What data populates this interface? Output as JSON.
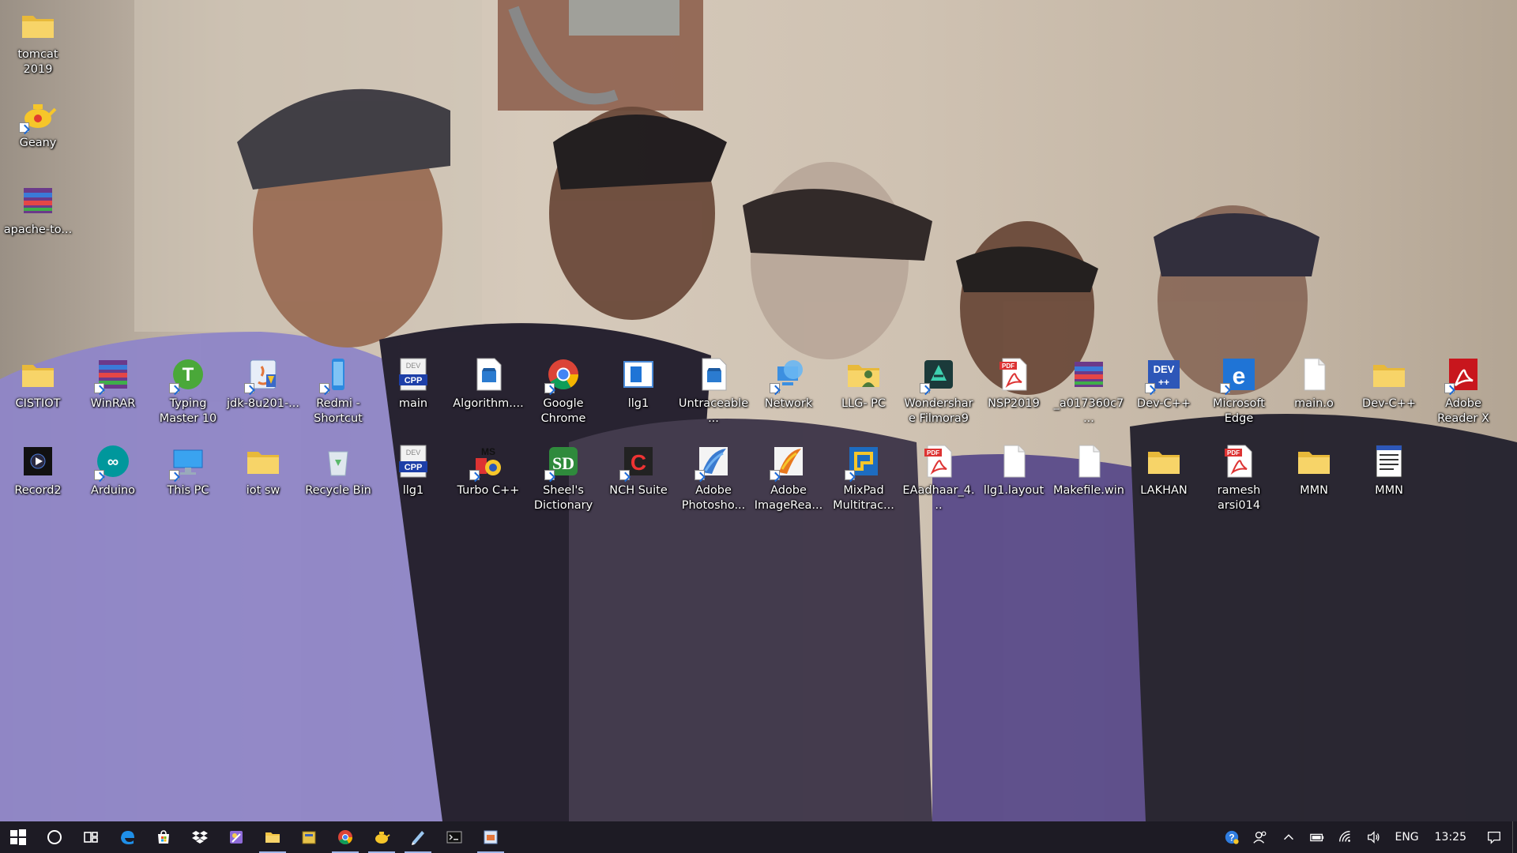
{
  "desktop": {
    "icons": [
      {
        "label": "tomcat 2019",
        "icon": "folder-icon"
      },
      {
        "label": "Geany",
        "icon": "geany-icon"
      },
      {
        "label": "apache-to...",
        "icon": "winrar-archive-icon"
      },
      {
        "label": "CISTIOT",
        "icon": "folder-icon"
      },
      {
        "label": "WinRAR",
        "icon": "winrar-icon"
      },
      {
        "label": "Typing Master 10",
        "icon": "typing-master-icon"
      },
      {
        "label": "jdk-8u201-...",
        "icon": "java-installer-icon"
      },
      {
        "label": "Redmi - Shortcut",
        "icon": "redmi-phone-icon"
      },
      {
        "label": "main",
        "icon": "cpp-file-icon"
      },
      {
        "label": "Algorithm....",
        "icon": "video-file-icon"
      },
      {
        "label": "Google Chrome",
        "icon": "chrome-icon"
      },
      {
        "label": "llg1",
        "icon": "window-app-icon"
      },
      {
        "label": "Untraceable...",
        "icon": "video-file-icon"
      },
      {
        "label": "Network",
        "icon": "network-icon"
      },
      {
        "label": "LLG- PC",
        "icon": "user-folder-icon"
      },
      {
        "label": "Wondershare Filmora9",
        "icon": "filmora-icon"
      },
      {
        "label": "NSP2019",
        "icon": "pdf-icon"
      },
      {
        "label": "_a017360c7...",
        "icon": "winrar-archive-icon"
      },
      {
        "label": "Dev-C++",
        "icon": "dev-cpp-icon"
      },
      {
        "label": "Microsoft Edge",
        "icon": "edge-icon"
      },
      {
        "label": "main.o",
        "icon": "blank-file-icon"
      },
      {
        "label": "Dev-C++",
        "icon": "folder-icon"
      },
      {
        "label": "Adobe Reader X",
        "icon": "adobe-reader-icon"
      },
      {
        "label": "Record2",
        "icon": "media-file-icon"
      },
      {
        "label": "Arduino",
        "icon": "arduino-icon"
      },
      {
        "label": "This PC",
        "icon": "this-pc-icon"
      },
      {
        "label": "iot sw",
        "icon": "folder-icon"
      },
      {
        "label": "Recycle Bin",
        "icon": "recycle-bin-icon"
      },
      {
        "label": "llg1",
        "icon": "cpp-file-icon"
      },
      {
        "label": "Turbo C++",
        "icon": "turbo-cpp-icon"
      },
      {
        "label": "Sheel's Dictionary",
        "icon": "dictionary-icon"
      },
      {
        "label": "NCH Suite",
        "icon": "nch-suite-icon"
      },
      {
        "label": "Adobe Photosho...",
        "icon": "photoshop-icon"
      },
      {
        "label": "Adobe ImageRea...",
        "icon": "imageready-icon"
      },
      {
        "label": "MixPad Multitrac...",
        "icon": "mixpad-icon"
      },
      {
        "label": "EAadhaar_4...",
        "icon": "pdf-icon"
      },
      {
        "label": "llg1.layout",
        "icon": "blank-file-icon"
      },
      {
        "label": "Makefile.win",
        "icon": "blank-file-icon"
      },
      {
        "label": "LAKHAN",
        "icon": "folder-icon"
      },
      {
        "label": "ramesh arsi014",
        "icon": "pdf-icon"
      },
      {
        "label": "MMN",
        "icon": "folder-icon"
      },
      {
        "label": "MMN",
        "icon": "text-document-icon"
      }
    ]
  },
  "taskbar": {
    "pinned": [
      {
        "name": "start-button",
        "icon": "windows-logo-icon"
      },
      {
        "name": "cortana-button",
        "icon": "search-circle-icon"
      },
      {
        "name": "task-view-button",
        "icon": "task-view-icon"
      },
      {
        "name": "edge-taskbar-button",
        "icon": "edge-icon"
      },
      {
        "name": "store-taskbar-button",
        "icon": "store-icon"
      },
      {
        "name": "dropbox-taskbar-button",
        "icon": "dropbox-icon"
      },
      {
        "name": "paint-taskbar-button",
        "icon": "paint-icon"
      },
      {
        "name": "explorer-taskbar-button",
        "icon": "folder-icon"
      },
      {
        "name": "archive-taskbar-button",
        "icon": "archive-icon"
      },
      {
        "name": "chrome-taskbar-button",
        "icon": "chrome-icon"
      },
      {
        "name": "geany-taskbar-button",
        "icon": "geany-icon"
      },
      {
        "name": "notepad-taskbar-button",
        "icon": "notepad-icon"
      },
      {
        "name": "terminal-taskbar-button",
        "icon": "terminal-icon"
      },
      {
        "name": "installer-taskbar-button",
        "icon": "installer-icon"
      }
    ],
    "tray": {
      "language": "ENG",
      "time": "13:25"
    }
  },
  "colors": {
    "taskbar_bg": "#1d1b24",
    "accent": "#9fb6e8"
  }
}
